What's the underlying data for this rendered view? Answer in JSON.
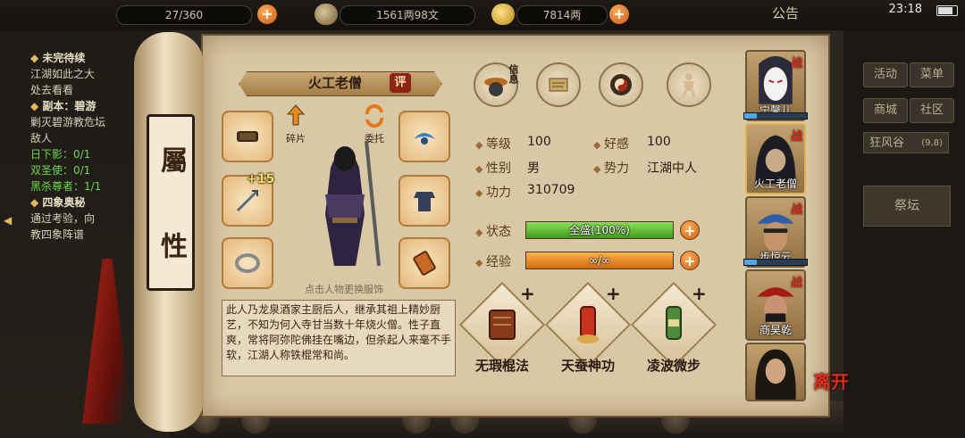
{
  "topbar": {
    "stamina": "27/360",
    "silver": "1561两98文",
    "gold": "7814两",
    "notice": "公告",
    "clock": "23:18"
  },
  "quest": {
    "items": [
      {
        "head": "未完待续",
        "lines": [
          "江湖如此之大",
          "处去看看"
        ]
      },
      {
        "head": "副本：碧游",
        "lines": [
          "剿灭碧游教危坛",
          "敌人"
        ],
        "progress": [
          "日下影：0/1",
          "双圣使：0/1",
          "黑杀尊者：1/1"
        ]
      },
      {
        "head": "四象奥秘",
        "lines": [
          "通过考验，向",
          "教四象阵谱"
        ]
      }
    ]
  },
  "rod": {
    "label_top": "屬",
    "label_bottom": "性"
  },
  "character": {
    "name": "火工老僧",
    "eval": "评",
    "fragments_label": "碎片",
    "entrust_label": "委托",
    "weapon_enhance": "+15",
    "hint": "点击人物更换服饰",
    "description": "此人乃龙泉酒家主厨后人，继承其祖上精妙厨艺，不知为何入寺甘当数十年烧火僧。性子直爽，常将阿弥陀佛挂在嘴边，但杀起人来毫不手软，江湖人称铁棍常和尚。"
  },
  "tabs": [
    {
      "icon": "info-hat-icon",
      "label": "信息"
    },
    {
      "icon": "scroll-icon"
    },
    {
      "icon": "bagua-icon"
    },
    {
      "icon": "meridian-body-icon"
    }
  ],
  "stats": {
    "level_label": "等级",
    "level": "100",
    "favor_label": "好感",
    "favor": "100",
    "gender_label": "性别",
    "gender": "男",
    "faction_label": "势力",
    "faction": "江湖中人",
    "power_label": "功力",
    "power": "310709",
    "state_label": "状态",
    "state_text": "全盛(100%)",
    "state_pct": 100,
    "exp_label": "经验",
    "exp_text": "∞/∞",
    "exp_pct": 100
  },
  "skills": [
    {
      "name": "无瑕棍法",
      "icon": "staff-technique-icon"
    },
    {
      "name": "天蚕神功",
      "icon": "silkworm-scroll-icon"
    },
    {
      "name": "凌波微步",
      "icon": "footwork-scroll-icon"
    }
  ],
  "roster": [
    {
      "name": "宁馨儿",
      "badge": "战",
      "bar_pct": 20
    },
    {
      "name": "火工老僧",
      "badge": "战",
      "selected": true
    },
    {
      "name": "步惊云",
      "badge": "战",
      "bar_pct": 20
    },
    {
      "name": "商昊乾",
      "badge": "战"
    },
    {
      "name": ""
    }
  ],
  "leave_label": "离开",
  "right_menu": {
    "activity": "活动",
    "menu": "菜单",
    "shop": "商城",
    "community": "社区",
    "location": "狂风谷",
    "location_coords": "(9,8)",
    "altar": "祭坛"
  },
  "colors": {
    "state_bar": "#5bb52c",
    "exp_bar": "#e48a1c",
    "accent_red": "#8e2415"
  }
}
